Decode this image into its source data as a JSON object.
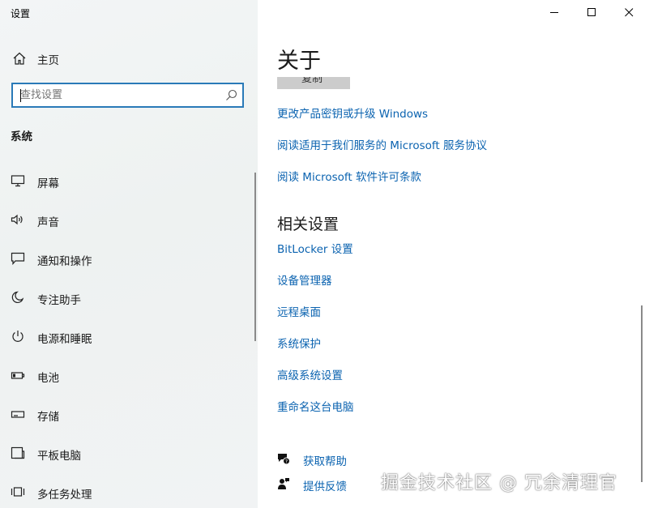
{
  "app": {
    "title": "设置"
  },
  "sidebar": {
    "home_label": "主页",
    "search": {
      "placeholder": "查找设置",
      "value": ""
    },
    "section_title": "系统",
    "items": [
      {
        "label": "屏幕",
        "icon": "monitor-icon"
      },
      {
        "label": "声音",
        "icon": "speaker-icon"
      },
      {
        "label": "通知和操作",
        "icon": "notification-icon"
      },
      {
        "label": "专注助手",
        "icon": "moon-icon"
      },
      {
        "label": "电源和睡眠",
        "icon": "power-icon"
      },
      {
        "label": "电池",
        "icon": "battery-icon"
      },
      {
        "label": "存储",
        "icon": "storage-icon"
      },
      {
        "label": "平板电脑",
        "icon": "tablet-icon"
      },
      {
        "label": "多任务处理",
        "icon": "multitask-icon"
      }
    ]
  },
  "main": {
    "page_title": "关于",
    "copy_button": "复制",
    "links": [
      "更改产品密钥或升级 Windows",
      "阅读适用于我们服务的 Microsoft 服务协议",
      "阅读 Microsoft 软件许可条款"
    ],
    "related_title": "相关设置",
    "related_links": [
      "BitLocker 设置",
      "设备管理器",
      "远程桌面",
      "系统保护",
      "高级系统设置",
      "重命名这台电脑"
    ],
    "help": [
      {
        "label": "获取帮助",
        "icon": "help-chat-icon"
      },
      {
        "label": "提供反馈",
        "icon": "feedback-icon"
      }
    ]
  },
  "watermark": "掘金技术社区 @ 冗余清理官",
  "colors": {
    "accent": "#0b63b0",
    "search_border": "#2a7ab8",
    "sidebar_bg": "#f1f3f4"
  }
}
